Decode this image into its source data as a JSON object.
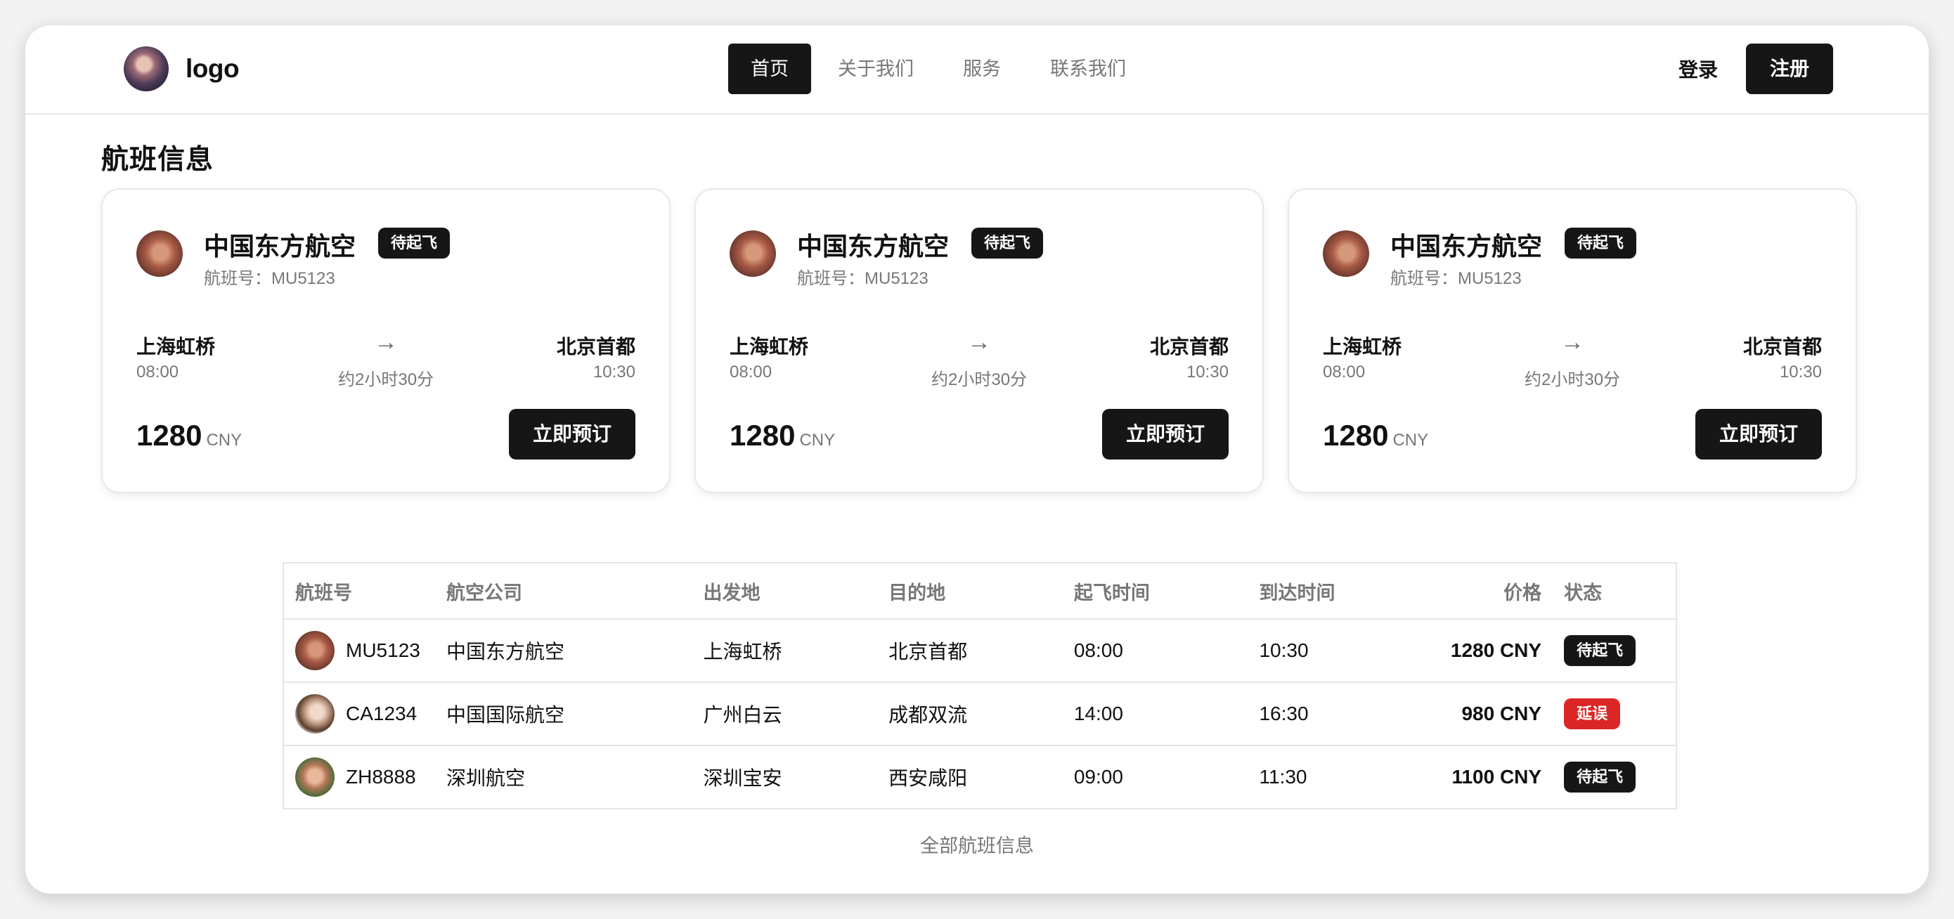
{
  "brand": {
    "name": "logo"
  },
  "nav": {
    "items": [
      {
        "label": "首页",
        "active": true
      },
      {
        "label": "关于我们",
        "active": false
      },
      {
        "label": "服务",
        "active": false
      },
      {
        "label": "联系我们",
        "active": false
      }
    ],
    "login_label": "登录",
    "register_label": "注册"
  },
  "section": {
    "title": "航班信息"
  },
  "cards": [
    {
      "airline": "中国东方航空",
      "status": "待起飞",
      "flight_no": "航班号：MU5123",
      "from": "上海虹桥",
      "dep_time": "08:00",
      "duration": "约2小时30分",
      "to": "北京首都",
      "arr_time": "10:30",
      "price": "1280",
      "currency": "CNY",
      "book_label": "立即预订"
    },
    {
      "airline": "中国东方航空",
      "status": "待起飞",
      "flight_no": "航班号：MU5123",
      "from": "上海虹桥",
      "dep_time": "08:00",
      "duration": "约2小时30分",
      "to": "北京首都",
      "arr_time": "10:30",
      "price": "1280",
      "currency": "CNY",
      "book_label": "立即预订"
    },
    {
      "airline": "中国东方航空",
      "status": "待起飞",
      "flight_no": "航班号：MU5123",
      "from": "上海虹桥",
      "dep_time": "08:00",
      "duration": "约2小时30分",
      "to": "北京首都",
      "arr_time": "10:30",
      "price": "1280",
      "currency": "CNY",
      "book_label": "立即预订"
    }
  ],
  "table": {
    "headers": [
      "航班号",
      "航空公司",
      "出发地",
      "目的地",
      "起飞时间",
      "到达时间",
      "价格",
      "状态"
    ],
    "rows": [
      {
        "flight": "MU5123",
        "airline": "中国东方航空",
        "from": "上海虹桥",
        "to": "北京首都",
        "dep": "08:00",
        "arr": "10:30",
        "price": "1280 CNY",
        "status": "待起飞"
      },
      {
        "flight": "CA1234",
        "airline": "中国国际航空",
        "from": "广州白云",
        "to": "成都双流",
        "dep": "14:00",
        "arr": "16:30",
        "price": "980 CNY",
        "status": "延误"
      },
      {
        "flight": "ZH8888",
        "airline": "深圳航空",
        "from": "深圳宝安",
        "to": "西安咸阳",
        "dep": "09:00",
        "arr": "11:30",
        "price": "1100 CNY",
        "status": "待起飞"
      }
    ]
  },
  "colors": {
    "status_scheduled": "#161616",
    "status_delayed": "#dc2626"
  },
  "footer": {
    "all_flights_label": "全部航班信息"
  }
}
